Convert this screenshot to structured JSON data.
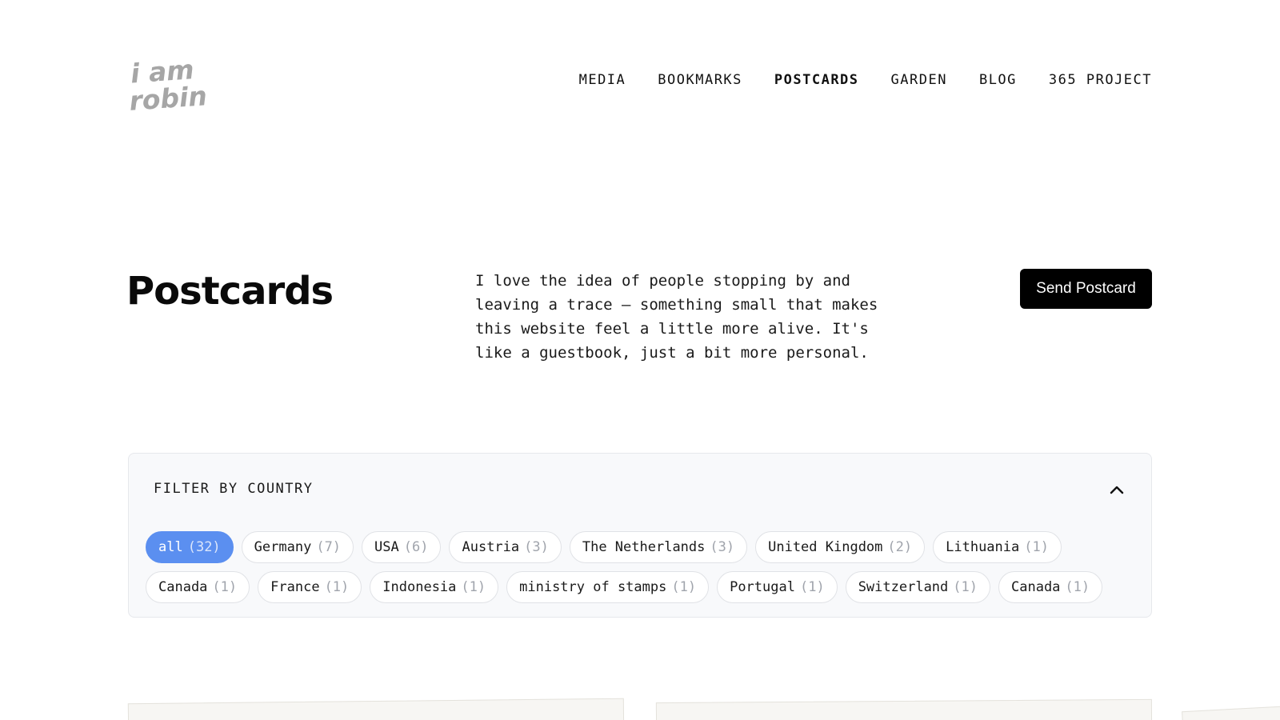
{
  "logo": {
    "line1": "i am",
    "line2": "robin"
  },
  "nav": {
    "items": [
      {
        "label": "MEDIA"
      },
      {
        "label": "BOOKMARKS"
      },
      {
        "label": "POSTCARDS"
      },
      {
        "label": "GARDEN"
      },
      {
        "label": "BLOG"
      },
      {
        "label": "365 PROJECT"
      }
    ],
    "active": "POSTCARDS"
  },
  "page": {
    "title": "Postcards",
    "intro": "I love the idea of people stopping by and leaving a trace — something small that makes this website feel a little more alive. It's like a guestbook, just a bit more personal.",
    "send_button": "Send Postcard"
  },
  "filter": {
    "heading": "FILTER BY COUNTRY",
    "toggle_icon": "chevron-up-icon",
    "active_color": "#5b8ff0",
    "chips": [
      {
        "label": "all",
        "count": "(32)",
        "active": true
      },
      {
        "label": "Germany",
        "count": "(7)"
      },
      {
        "label": "USA",
        "count": "(6)"
      },
      {
        "label": "Austria",
        "count": "(3)"
      },
      {
        "label": "The Netherlands",
        "count": "(3)"
      },
      {
        "label": "United Kingdom",
        "count": "(2)"
      },
      {
        "label": "Lithuania",
        "count": "(1)"
      },
      {
        "label": "Canada",
        "count": "(1)"
      },
      {
        "label": "France",
        "count": "(1)"
      },
      {
        "label": "Indonesia",
        "count": "(1)"
      },
      {
        "label": "ministry of stamps",
        "count": "(1)"
      },
      {
        "label": "Portugal",
        "count": "(1)"
      },
      {
        "label": "Switzerland",
        "count": "(1)"
      },
      {
        "label": "Canada",
        "count": "(1)"
      }
    ]
  }
}
